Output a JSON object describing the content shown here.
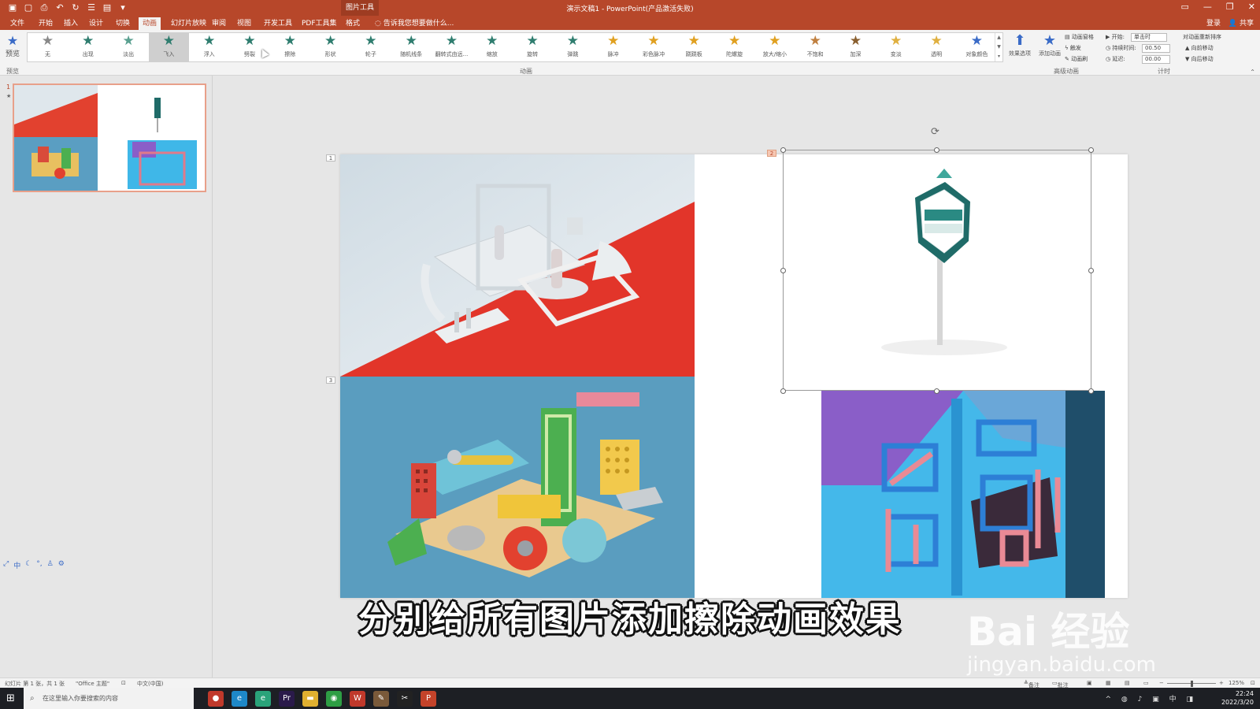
{
  "titlebar": {
    "context_label": "图片工具",
    "title": "演示文稿1 - PowerPoint(产品激活失败)",
    "qat": [
      "save-icon",
      "new-icon",
      "print-preview-icon",
      "undo-icon",
      "redo-icon",
      "touch-mode-icon",
      "open-icon",
      "customize-icon"
    ]
  },
  "tabs": [
    "文件",
    "开始",
    "插入",
    "设计",
    "切换",
    "动画",
    "幻灯片放映",
    "审阅",
    "视图",
    "开发工具",
    "PDF工具集",
    "格式"
  ],
  "active_tab": "动画",
  "tell_me": "告诉我您想要做什么...",
  "login": "登录",
  "share": "共享",
  "ribbon": {
    "preview_label": "预览",
    "preview_group": "预览",
    "animation_group": "动画",
    "advanced_group": "高级动画",
    "timing_group": "计时",
    "effects": [
      {
        "label": "无",
        "color": "#888888"
      },
      {
        "label": "出现",
        "color": "#2f7d6f"
      },
      {
        "label": "淡出",
        "color": "#5aa090"
      },
      {
        "label": "飞入",
        "color": "#2f7d6f"
      },
      {
        "label": "浮入",
        "color": "#2f7d6f"
      },
      {
        "label": "劈裂",
        "color": "#2f7d6f"
      },
      {
        "label": "擦除",
        "color": "#2f7d6f"
      },
      {
        "label": "形状",
        "color": "#2f7d6f"
      },
      {
        "label": "轮子",
        "color": "#2f7d6f"
      },
      {
        "label": "随机线条",
        "color": "#2f7d6f"
      },
      {
        "label": "翻转式由远...",
        "color": "#2f7d6f"
      },
      {
        "label": "缩放",
        "color": "#2f7d6f"
      },
      {
        "label": "旋转",
        "color": "#2f7d6f"
      },
      {
        "label": "弹跳",
        "color": "#2f7d6f"
      },
      {
        "label": "脉冲",
        "color": "#e0a020"
      },
      {
        "label": "彩色脉冲",
        "color": "#e0a020"
      },
      {
        "label": "跷跷板",
        "color": "#e0a020"
      },
      {
        "label": "陀螺旋",
        "color": "#e0a020"
      },
      {
        "label": "放大/缩小",
        "color": "#e0a020"
      },
      {
        "label": "不饱和",
        "color": "#c08040"
      },
      {
        "label": "加深",
        "color": "#8a6030"
      },
      {
        "label": "变淡",
        "color": "#e0b040"
      },
      {
        "label": "透明",
        "color": "#e0b040"
      },
      {
        "label": "对象颜色",
        "color": "#3a6bc7"
      }
    ],
    "selected_effect": "飞入",
    "effect_options": "效果选项",
    "add_animation": "添加动画",
    "animation_pane": "动画窗格",
    "trigger": "触发",
    "animation_painter": "动画刷",
    "start_label": "开始:",
    "start_value": "单击时",
    "duration_label": "持续时间:",
    "duration_value": "00.50",
    "delay_label": "延迟:",
    "delay_value": "00.00",
    "reorder_label": "对动画重新排序",
    "move_earlier": "向前移动",
    "move_later": "向后移动"
  },
  "thumbnails": {
    "slide_number": "1",
    "slide_star": "★"
  },
  "slide": {
    "tags": [
      "1",
      "2",
      "3"
    ],
    "rotate_icon": "⟳"
  },
  "subtitle": "分别给所有图片添加擦除动画效果",
  "watermark": {
    "logo": "Bai 经验",
    "url": "jingyan.baidu.com"
  },
  "statusbar": {
    "slide_info": "幻灯片 第 1 张，共 1 张",
    "theme": "\"Office 主题\"",
    "language": "中文(中国)",
    "notes": "备注",
    "comments": "批注",
    "zoom": "125%"
  },
  "taskbar": {
    "search_placeholder": "在这里输入你要搜索的内容",
    "time": "22:24",
    "date": "2022/3/20",
    "ime": "中",
    "apps": [
      {
        "name": "record-app",
        "color": "#c0392b",
        "glyph": "●"
      },
      {
        "name": "edge-app",
        "color": "#1e88c8",
        "glyph": "e"
      },
      {
        "name": "edge-beta-app",
        "color": "#2aa37a",
        "glyph": "e"
      },
      {
        "name": "premiere-app",
        "color": "#2a1a4a",
        "glyph": "Pr"
      },
      {
        "name": "explorer-app",
        "color": "#e0b030",
        "glyph": "▬"
      },
      {
        "name": "chrome-app",
        "color": "#2e9e44",
        "glyph": "◉"
      },
      {
        "name": "wps-app",
        "color": "#c0392b",
        "glyph": "W"
      },
      {
        "name": "paint-app",
        "color": "#7a5a3a",
        "glyph": "✎"
      },
      {
        "name": "capcut-app",
        "color": "#222222",
        "glyph": "✂"
      },
      {
        "name": "powerpoint-app",
        "color": "#c4432a",
        "glyph": "P"
      }
    ]
  }
}
